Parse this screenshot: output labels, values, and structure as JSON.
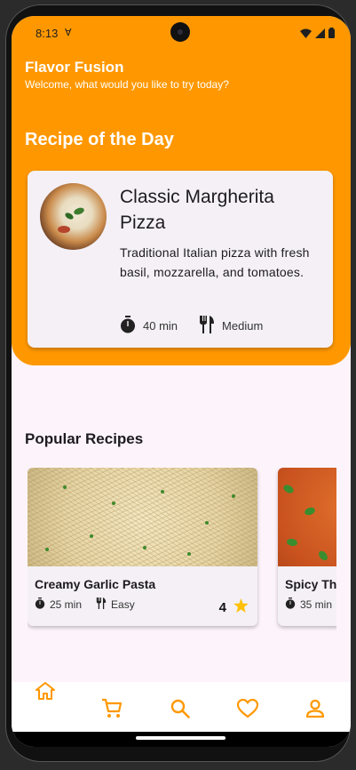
{
  "status_bar": {
    "time": "8:13",
    "net_indicator": "∀"
  },
  "header": {
    "title": "Flavor Fusion",
    "subtitle": "Welcome, what would you like to try today?"
  },
  "recipe_of_the_day": {
    "heading": "Recipe of the Day",
    "title": "Classic Margherita Pizza",
    "description": "Traditional Italian pizza with fresh basil, mozzarella, and tomatoes.",
    "time": "40 min",
    "difficulty": "Medium"
  },
  "popular": {
    "heading": "Popular Recipes",
    "items": [
      {
        "title": "Creamy Garlic Pasta",
        "time": "25 min",
        "difficulty": "Easy",
        "rating": "4"
      },
      {
        "title": "Spicy Thai Curry",
        "time": "35 min",
        "difficulty": "",
        "rating": ""
      }
    ]
  },
  "bottom_nav": {
    "items": [
      {
        "icon": "home-icon",
        "selected": true
      },
      {
        "icon": "cart-icon",
        "selected": false
      },
      {
        "icon": "search-icon",
        "selected": false
      },
      {
        "icon": "heart-icon",
        "selected": false
      },
      {
        "icon": "profile-icon",
        "selected": false
      }
    ]
  },
  "colors": {
    "accent": "#ff9800",
    "background": "#fdf4fb",
    "card": "#f4f0f6",
    "star": "#ffc107"
  }
}
